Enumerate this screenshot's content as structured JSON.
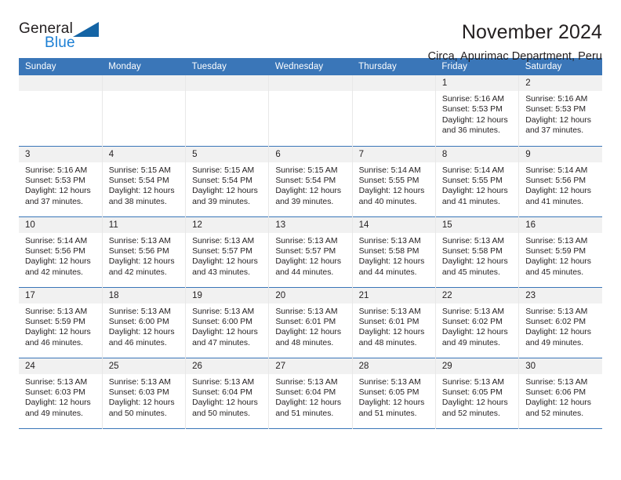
{
  "brand": {
    "name_part1": "General",
    "name_part2": "Blue",
    "accent_color": "#1464a5",
    "blue_text_color": "#1c7fd4"
  },
  "header": {
    "title": "November 2024",
    "subtitle": "Circa, Apurimac Department, Peru"
  },
  "calendar": {
    "header_bg": "#3a76b8",
    "daynum_bg": "#f1f1f1",
    "weekday_labels": [
      "Sunday",
      "Monday",
      "Tuesday",
      "Wednesday",
      "Thursday",
      "Friday",
      "Saturday"
    ],
    "weeks": [
      [
        {
          "day": "",
          "empty": true
        },
        {
          "day": "",
          "empty": true
        },
        {
          "day": "",
          "empty": true
        },
        {
          "day": "",
          "empty": true
        },
        {
          "day": "",
          "empty": true
        },
        {
          "day": "1",
          "sunrise": "Sunrise: 5:16 AM",
          "sunset": "Sunset: 5:53 PM",
          "daylight_line1": "Daylight: 12 hours",
          "daylight_line2": "and 36 minutes."
        },
        {
          "day": "2",
          "sunrise": "Sunrise: 5:16 AM",
          "sunset": "Sunset: 5:53 PM",
          "daylight_line1": "Daylight: 12 hours",
          "daylight_line2": "and 37 minutes."
        }
      ],
      [
        {
          "day": "3",
          "sunrise": "Sunrise: 5:16 AM",
          "sunset": "Sunset: 5:53 PM",
          "daylight_line1": "Daylight: 12 hours",
          "daylight_line2": "and 37 minutes."
        },
        {
          "day": "4",
          "sunrise": "Sunrise: 5:15 AM",
          "sunset": "Sunset: 5:54 PM",
          "daylight_line1": "Daylight: 12 hours",
          "daylight_line2": "and 38 minutes."
        },
        {
          "day": "5",
          "sunrise": "Sunrise: 5:15 AM",
          "sunset": "Sunset: 5:54 PM",
          "daylight_line1": "Daylight: 12 hours",
          "daylight_line2": "and 39 minutes."
        },
        {
          "day": "6",
          "sunrise": "Sunrise: 5:15 AM",
          "sunset": "Sunset: 5:54 PM",
          "daylight_line1": "Daylight: 12 hours",
          "daylight_line2": "and 39 minutes."
        },
        {
          "day": "7",
          "sunrise": "Sunrise: 5:14 AM",
          "sunset": "Sunset: 5:55 PM",
          "daylight_line1": "Daylight: 12 hours",
          "daylight_line2": "and 40 minutes."
        },
        {
          "day": "8",
          "sunrise": "Sunrise: 5:14 AM",
          "sunset": "Sunset: 5:55 PM",
          "daylight_line1": "Daylight: 12 hours",
          "daylight_line2": "and 41 minutes."
        },
        {
          "day": "9",
          "sunrise": "Sunrise: 5:14 AM",
          "sunset": "Sunset: 5:56 PM",
          "daylight_line1": "Daylight: 12 hours",
          "daylight_line2": "and 41 minutes."
        }
      ],
      [
        {
          "day": "10",
          "sunrise": "Sunrise: 5:14 AM",
          "sunset": "Sunset: 5:56 PM",
          "daylight_line1": "Daylight: 12 hours",
          "daylight_line2": "and 42 minutes."
        },
        {
          "day": "11",
          "sunrise": "Sunrise: 5:13 AM",
          "sunset": "Sunset: 5:56 PM",
          "daylight_line1": "Daylight: 12 hours",
          "daylight_line2": "and 42 minutes."
        },
        {
          "day": "12",
          "sunrise": "Sunrise: 5:13 AM",
          "sunset": "Sunset: 5:57 PM",
          "daylight_line1": "Daylight: 12 hours",
          "daylight_line2": "and 43 minutes."
        },
        {
          "day": "13",
          "sunrise": "Sunrise: 5:13 AM",
          "sunset": "Sunset: 5:57 PM",
          "daylight_line1": "Daylight: 12 hours",
          "daylight_line2": "and 44 minutes."
        },
        {
          "day": "14",
          "sunrise": "Sunrise: 5:13 AM",
          "sunset": "Sunset: 5:58 PM",
          "daylight_line1": "Daylight: 12 hours",
          "daylight_line2": "and 44 minutes."
        },
        {
          "day": "15",
          "sunrise": "Sunrise: 5:13 AM",
          "sunset": "Sunset: 5:58 PM",
          "daylight_line1": "Daylight: 12 hours",
          "daylight_line2": "and 45 minutes."
        },
        {
          "day": "16",
          "sunrise": "Sunrise: 5:13 AM",
          "sunset": "Sunset: 5:59 PM",
          "daylight_line1": "Daylight: 12 hours",
          "daylight_line2": "and 45 minutes."
        }
      ],
      [
        {
          "day": "17",
          "sunrise": "Sunrise: 5:13 AM",
          "sunset": "Sunset: 5:59 PM",
          "daylight_line1": "Daylight: 12 hours",
          "daylight_line2": "and 46 minutes."
        },
        {
          "day": "18",
          "sunrise": "Sunrise: 5:13 AM",
          "sunset": "Sunset: 6:00 PM",
          "daylight_line1": "Daylight: 12 hours",
          "daylight_line2": "and 46 minutes."
        },
        {
          "day": "19",
          "sunrise": "Sunrise: 5:13 AM",
          "sunset": "Sunset: 6:00 PM",
          "daylight_line1": "Daylight: 12 hours",
          "daylight_line2": "and 47 minutes."
        },
        {
          "day": "20",
          "sunrise": "Sunrise: 5:13 AM",
          "sunset": "Sunset: 6:01 PM",
          "daylight_line1": "Daylight: 12 hours",
          "daylight_line2": "and 48 minutes."
        },
        {
          "day": "21",
          "sunrise": "Sunrise: 5:13 AM",
          "sunset": "Sunset: 6:01 PM",
          "daylight_line1": "Daylight: 12 hours",
          "daylight_line2": "and 48 minutes."
        },
        {
          "day": "22",
          "sunrise": "Sunrise: 5:13 AM",
          "sunset": "Sunset: 6:02 PM",
          "daylight_line1": "Daylight: 12 hours",
          "daylight_line2": "and 49 minutes."
        },
        {
          "day": "23",
          "sunrise": "Sunrise: 5:13 AM",
          "sunset": "Sunset: 6:02 PM",
          "daylight_line1": "Daylight: 12 hours",
          "daylight_line2": "and 49 minutes."
        }
      ],
      [
        {
          "day": "24",
          "sunrise": "Sunrise: 5:13 AM",
          "sunset": "Sunset: 6:03 PM",
          "daylight_line1": "Daylight: 12 hours",
          "daylight_line2": "and 49 minutes."
        },
        {
          "day": "25",
          "sunrise": "Sunrise: 5:13 AM",
          "sunset": "Sunset: 6:03 PM",
          "daylight_line1": "Daylight: 12 hours",
          "daylight_line2": "and 50 minutes."
        },
        {
          "day": "26",
          "sunrise": "Sunrise: 5:13 AM",
          "sunset": "Sunset: 6:04 PM",
          "daylight_line1": "Daylight: 12 hours",
          "daylight_line2": "and 50 minutes."
        },
        {
          "day": "27",
          "sunrise": "Sunrise: 5:13 AM",
          "sunset": "Sunset: 6:04 PM",
          "daylight_line1": "Daylight: 12 hours",
          "daylight_line2": "and 51 minutes."
        },
        {
          "day": "28",
          "sunrise": "Sunrise: 5:13 AM",
          "sunset": "Sunset: 6:05 PM",
          "daylight_line1": "Daylight: 12 hours",
          "daylight_line2": "and 51 minutes."
        },
        {
          "day": "29",
          "sunrise": "Sunrise: 5:13 AM",
          "sunset": "Sunset: 6:05 PM",
          "daylight_line1": "Daylight: 12 hours",
          "daylight_line2": "and 52 minutes."
        },
        {
          "day": "30",
          "sunrise": "Sunrise: 5:13 AM",
          "sunset": "Sunset: 6:06 PM",
          "daylight_line1": "Daylight: 12 hours",
          "daylight_line2": "and 52 minutes."
        }
      ]
    ]
  }
}
